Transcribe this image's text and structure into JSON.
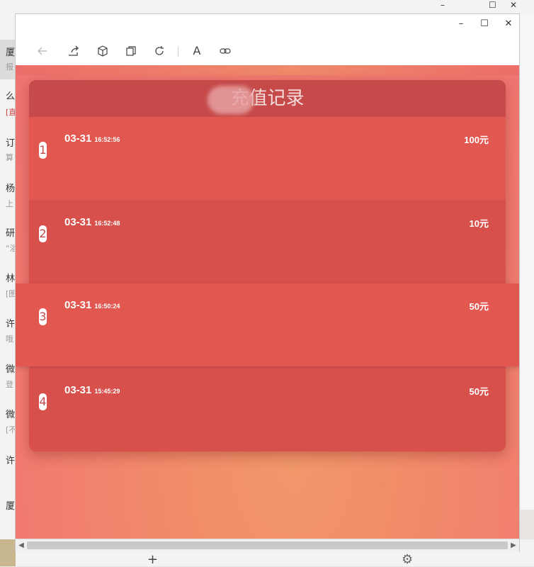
{
  "background": {
    "left_chars": [
      {
        "t": "厦",
        "cls": ""
      },
      {
        "t": "报",
        "cls": "sub"
      },
      {
        "t": "么",
        "cls": ""
      },
      {
        "t": "[直",
        "cls": "sub red"
      },
      {
        "t": "订",
        "cls": ""
      },
      {
        "t": "算",
        "cls": "sub"
      },
      {
        "t": "杨",
        "cls": ""
      },
      {
        "t": "上",
        "cls": "sub"
      },
      {
        "t": "研",
        "cls": ""
      },
      {
        "t": "“浴",
        "cls": "sub"
      },
      {
        "t": "林",
        "cls": ""
      },
      {
        "t": "[图",
        "cls": "sub"
      },
      {
        "t": "许",
        "cls": ""
      },
      {
        "t": "哦",
        "cls": "sub"
      },
      {
        "t": "微",
        "cls": ""
      },
      {
        "t": "登",
        "cls": "sub"
      },
      {
        "t": "微",
        "cls": ""
      },
      {
        "t": "[不",
        "cls": "sub"
      },
      {
        "t": "许",
        "cls": ""
      },
      {
        "t": "厦",
        "cls": ""
      }
    ]
  },
  "window": {
    "minimize_icon": "–",
    "maximize_icon": "☐",
    "close_icon": "✕"
  },
  "toolbar": {
    "back_icon": "back-arrow",
    "share_icon": "share",
    "cube_icon": "cube",
    "copy_icon": "copy",
    "refresh_icon": "refresh",
    "font_label": "A",
    "link_icon": "link"
  },
  "page": {
    "title": "充值记录",
    "records": [
      {
        "index": "1",
        "date": "03-31",
        "time": "16:52:56",
        "amount": "100元"
      },
      {
        "index": "2",
        "date": "03-31",
        "time": "16:52:48",
        "amount": "10元"
      },
      {
        "index": "3",
        "date": "03-31",
        "time": "16:50:24",
        "amount": "50元"
      },
      {
        "index": "4",
        "date": "03-31",
        "time": "15:45:29",
        "amount": "50元"
      }
    ]
  },
  "colors": {
    "card": "#d9534f",
    "header": "#c64a4a",
    "gradient_center": "#f0976a",
    "gradient_edge": "#ef7470"
  }
}
